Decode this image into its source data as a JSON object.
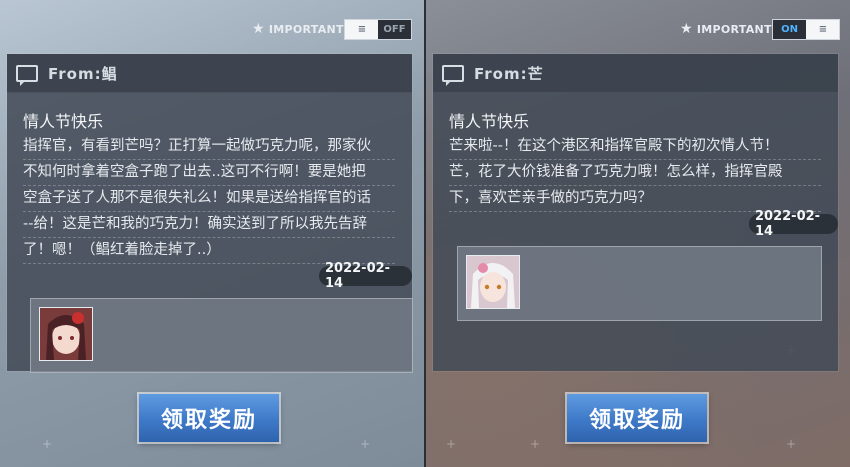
{
  "important_label": "IMPORTANT",
  "left_panel": {
    "toggle": {
      "state": "OFF",
      "off_label": "OFF"
    },
    "from_label": "From:鲳",
    "title": "情人节快乐",
    "body_lines": [
      "指挥官，有看到芒吗？正打算一起做巧克力呢，那家伙",
      "不知何时拿着空盒子跑了出去..这可不行啊！要是她把",
      "空盒子送了人那不是很失礼么！如果是送给指挥官的话",
      "--给！这是芒和我的巧克力！确实送到了所以我先告辞",
      "了！嗯！（鲳红着脸走掉了..）"
    ],
    "date": "2022-02-14",
    "avatar_icon": "character-portrait-icon",
    "claim_button": "领取奖励"
  },
  "right_panel": {
    "toggle": {
      "state": "ON",
      "on_label": "ON"
    },
    "from_label": "From:芒",
    "title": "情人节快乐",
    "body_lines": [
      "芒来啦--！在这个港区和指挥官殿下的初次情人节！",
      "芒，花了大价钱准备了巧克力哦！怎么样，指挥官殿",
      "下，喜欢芒亲手做的巧克力吗？"
    ],
    "date": "2022-02-14",
    "avatar_icon": "character-portrait-icon",
    "claim_button": "领取奖励"
  },
  "colors": {
    "button_blue": "#3e79c8",
    "toggle_on": "#4fb2ff"
  }
}
